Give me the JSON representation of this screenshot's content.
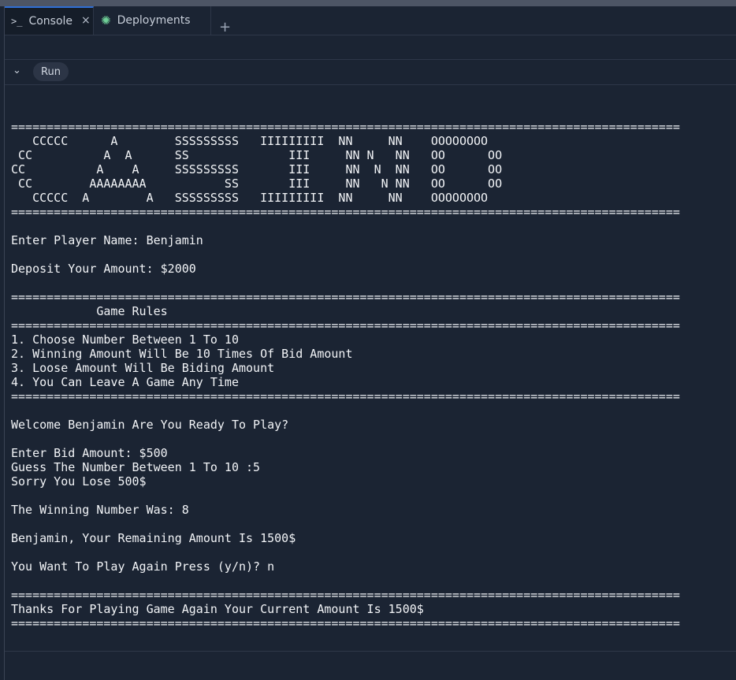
{
  "tabs": [
    {
      "label": "Console",
      "icon": "terminal-icon"
    },
    {
      "label": "Deployments",
      "icon": "deploy-icon"
    }
  ],
  "toolbar": {
    "run_label": "Run"
  },
  "console": {
    "output": "\n==============================================================================================\n   CCCCC      A        SSSSSSSSS   IIIIIIIII  NN     NN    OOOOOOOO\n CC          A  A      SS              III     NN N   NN   OO      OO\nCC          A    A     SSSSSSSSS       III     NN  N  NN   OO      OO\n CC        AAAAAAAA           SS       III     NN   N NN   OO      OO\n   CCCCC  A        A   SSSSSSSSS   IIIIIIIII  NN     NN    OOOOOOOO\n==============================================================================================\n\nEnter Player Name: Benjamin\n\nDeposit Your Amount: $2000\n\n==============================================================================================\n            Game Rules\n==============================================================================================\n1. Choose Number Between 1 To 10\n2. Winning Amount Will Be 10 Times Of Bid Amount\n3. Loose Amount Will Be Biding Amount\n4. You Can Leave A Game Any Time\n==============================================================================================\n\nWelcome Benjamin Are You Ready To Play?\n\nEnter Bid Amount: $500\nGuess The Number Between 1 To 10 :5\nSorry You Lose 500$\n\nThe Winning Number Was: 8\n\nBenjamin, Your Remaining Amount Is 1500$\n\nYou Want To Play Again Press (y/n)? n\n\n==============================================================================================\nThanks For Playing Game Again Your Current Amount Is 1500$\n=============================================================================================="
  }
}
